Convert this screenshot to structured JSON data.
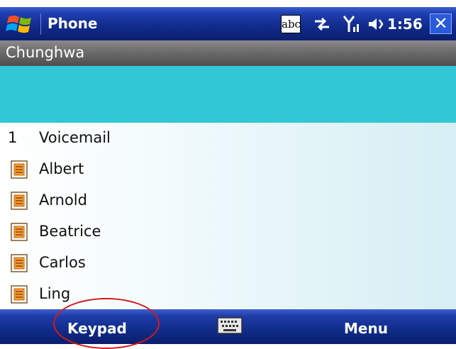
{
  "titlebar": {
    "app_title": "Phone",
    "input_mode": "abc",
    "clock": "1:56",
    "close_label": "✕",
    "icons": [
      "start-icon",
      "input-mode-icon",
      "sync-icon",
      "signal-icon",
      "volume-icon",
      "close-icon"
    ]
  },
  "operator": {
    "name": "Chunghwa"
  },
  "dial": {
    "number": ""
  },
  "list": {
    "voicemail": {
      "shortcut": "1",
      "label": "Voicemail"
    },
    "contacts": [
      {
        "name": "Albert"
      },
      {
        "name": "Arnold"
      },
      {
        "name": "Beatrice"
      },
      {
        "name": "Carlos"
      },
      {
        "name": "Ling"
      }
    ]
  },
  "softkeys": {
    "left": "Keypad",
    "center_icon": "keyboard-icon",
    "right": "Menu"
  },
  "colors": {
    "titlebar": "#102a8a",
    "dial_area": "#31c7d6",
    "annotation": "#d21a1a"
  }
}
